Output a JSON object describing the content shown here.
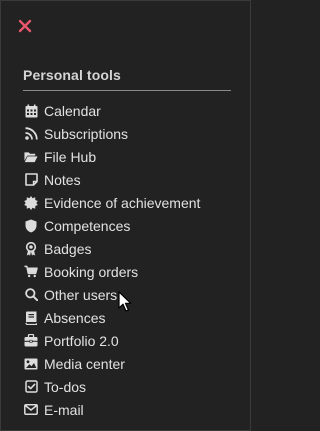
{
  "panel": {
    "close_icon": "close-x-icon",
    "accent_color": "#e8566c",
    "section_title": "Personal tools"
  },
  "menu": {
    "items": [
      {
        "label": "Calendar",
        "icon": "calendar-icon"
      },
      {
        "label": "Subscriptions",
        "icon": "rss-icon"
      },
      {
        "label": "File Hub",
        "icon": "folder-open-icon"
      },
      {
        "label": "Notes",
        "icon": "note-icon"
      },
      {
        "label": "Evidence of achievement",
        "icon": "certificate-icon"
      },
      {
        "label": "Competences",
        "icon": "shield-icon"
      },
      {
        "label": "Badges",
        "icon": "badge-icon"
      },
      {
        "label": "Booking orders",
        "icon": "cart-icon"
      },
      {
        "label": "Other users",
        "icon": "search-icon"
      },
      {
        "label": "Absences",
        "icon": "book-icon"
      },
      {
        "label": "Portfolio 2.0",
        "icon": "briefcase-icon"
      },
      {
        "label": "Media center",
        "icon": "image-icon"
      },
      {
        "label": "To-dos",
        "icon": "checkbox-icon"
      },
      {
        "label": "E-mail",
        "icon": "envelope-icon"
      }
    ]
  }
}
